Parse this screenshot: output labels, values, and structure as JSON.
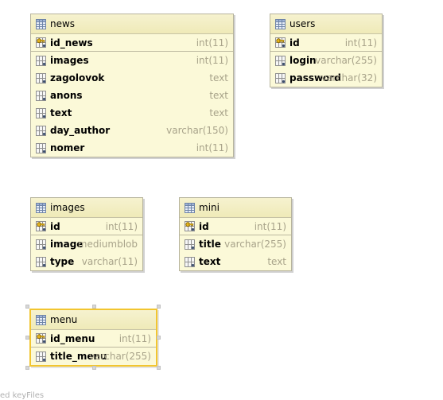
{
  "tables": [
    {
      "key": "news",
      "title": "news",
      "columns": [
        {
          "name": "id_news",
          "type": "int(11)",
          "kind": "pk"
        },
        {
          "name": "images",
          "type": "int(11)",
          "kind": "col"
        },
        {
          "name": "zagolovok",
          "type": "text",
          "kind": "col"
        },
        {
          "name": "anons",
          "type": "text",
          "kind": "col"
        },
        {
          "name": "text",
          "type": "text",
          "kind": "col"
        },
        {
          "name": "day_author",
          "type": "varchar(150)",
          "kind": "col"
        },
        {
          "name": "nomer",
          "type": "int(11)",
          "kind": "col"
        }
      ]
    },
    {
      "key": "users",
      "title": "users",
      "columns": [
        {
          "name": "id",
          "type": "int(11)",
          "kind": "pk"
        },
        {
          "name": "login",
          "type": "varchar(255)",
          "kind": "col"
        },
        {
          "name": "password",
          "type": "varchar(32)",
          "kind": "col"
        }
      ]
    },
    {
      "key": "images",
      "title": "images",
      "columns": [
        {
          "name": "id",
          "type": "int(11)",
          "kind": "pk"
        },
        {
          "name": "image",
          "type": "mediumblob",
          "kind": "col"
        },
        {
          "name": "type",
          "type": "varchar(11)",
          "kind": "col"
        }
      ]
    },
    {
      "key": "mini",
      "title": "mini",
      "columns": [
        {
          "name": "id",
          "type": "int(11)",
          "kind": "pk"
        },
        {
          "name": "title",
          "type": "varchar(255)",
          "kind": "col"
        },
        {
          "name": "text",
          "type": "text",
          "kind": "col"
        }
      ]
    },
    {
      "key": "menu",
      "title": "menu",
      "selected": true,
      "columns": [
        {
          "name": "id_menu",
          "type": "int(11)",
          "kind": "pk"
        },
        {
          "name": "title_menu",
          "type": "varchar(255)",
          "kind": "col"
        }
      ]
    }
  ],
  "footer": {
    "text": "ed keyFiles"
  },
  "icons": {
    "table": "table-icon",
    "pk": "key-column-icon",
    "column": "column-icon"
  }
}
